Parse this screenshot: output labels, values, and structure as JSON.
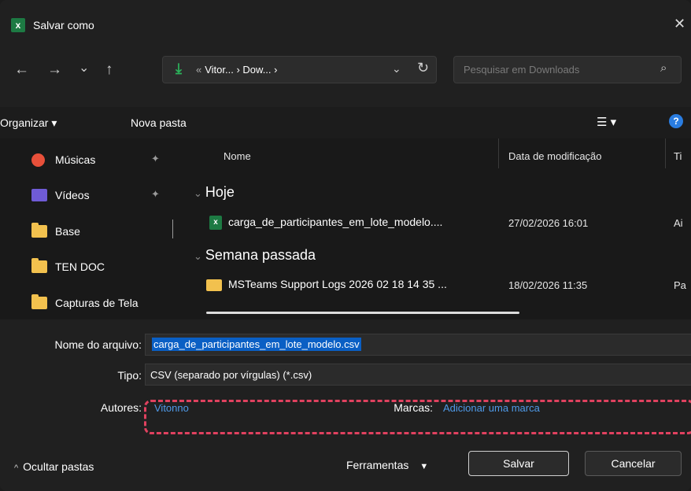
{
  "window": {
    "title": "Salvar como",
    "app_icon": "excel-icon",
    "close": "✕"
  },
  "nav": {
    "back": "←",
    "forward": "→",
    "recent": "⌄",
    "up": "↑"
  },
  "address": {
    "prefix": "«",
    "crumbs": "Vitor... › Dow... ›",
    "dropdown": "⌄",
    "refresh": "↻"
  },
  "search": {
    "placeholder": "Pesquisar em Downloads",
    "icon": "search-icon"
  },
  "toolbar": {
    "organize": "Organizar ▾",
    "new_folder": "Nova pasta",
    "view_icon": "☰ ▾",
    "help_icon": "?"
  },
  "sidebar": {
    "items": [
      {
        "label": "Músicas",
        "icon": "music-icon",
        "color": "#e8503a",
        "pinned": true
      },
      {
        "label": "Vídeos",
        "icon": "video-icon",
        "color": "#6f5bd6",
        "pinned": true
      },
      {
        "label": "Base",
        "icon": "folder-icon",
        "color": "#f2c14e",
        "pinned": false
      },
      {
        "label": "TEN DOC",
        "icon": "folder-icon",
        "color": "#f2c14e",
        "pinned": false
      },
      {
        "label": "Capturas de Tela",
        "icon": "folder-icon",
        "color": "#f2c14e",
        "pinned": false
      }
    ]
  },
  "columns": {
    "name": "Nome",
    "date": "Data de modificação",
    "type": "Ti"
  },
  "groups": [
    {
      "label": "Hoje",
      "rows": [
        {
          "name": "carga_de_participantes_em_lote_modelo....",
          "date": "27/02/2026 16:01",
          "type": "Ai",
          "icon": "excel-file-icon"
        }
      ]
    },
    {
      "label": "Semana passada",
      "rows": [
        {
          "name": "MSTeams Support Logs 2026 02 18 14 35 ...",
          "date": "18/02/2026 11:35",
          "type": "Pa",
          "icon": "folder-icon"
        }
      ]
    }
  ],
  "form": {
    "filename_label": "Nome do arquivo:",
    "filename_value": "carga_de_participantes_em_lote_modelo.csv",
    "type_label": "Tipo:",
    "type_value": "CSV (separado por vírgulas) (*.csv)",
    "authors_label": "Autores:",
    "authors_value": "Vitonno",
    "tags_label": "Marcas:",
    "tags_value": "Adicionar uma marca"
  },
  "footer": {
    "hide_folders": "Ocultar pastas",
    "tools": "Ferramentas",
    "save": "Salvar",
    "cancel": "Cancelar"
  },
  "colors": {
    "accent": "#0a5fc4",
    "highlight_dash": "#e0415f",
    "link": "#4f9ae8"
  }
}
